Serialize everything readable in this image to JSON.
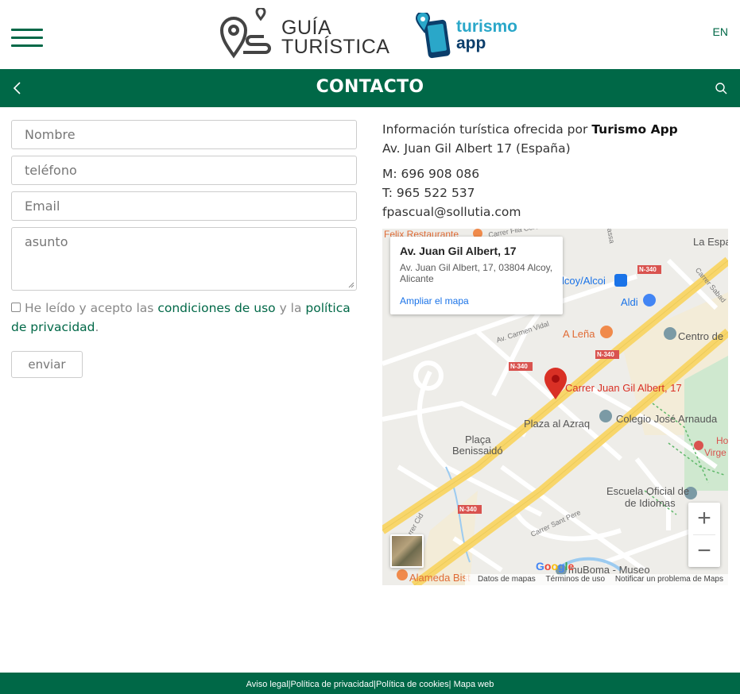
{
  "header": {
    "logo_guia_line1": "GUÍA",
    "logo_guia_line2": "TURÍSTICA",
    "logo_turismo_line1": "turismo",
    "logo_turismo_line2": "app",
    "lang": "EN"
  },
  "titlebar": {
    "title": "CONTACTO"
  },
  "form": {
    "name_placeholder": "Nombre",
    "phone_placeholder": "teléfono",
    "email_placeholder": "Email",
    "subject_placeholder": "asunto",
    "consent_prefix": "He leído y acepto las ",
    "terms_link": "condiciones de uso",
    "consent_middle": " y la ",
    "privacy_link": "política de privacidad",
    "consent_suffix": ".",
    "send_label": "enviar"
  },
  "info": {
    "intro": "Información turística ofrecida por ",
    "company": "Turismo App",
    "address": "Av. Juan Gil Albert 17 (España)",
    "mobile": "M: 696 908 086",
    "phone": "T: 965 522 537",
    "email": "fpascual@sollutia.com"
  },
  "map": {
    "popup_title": "Av. Juan Gil Albert, 17",
    "popup_address": "Av. Juan Gil Albert, 17, 03804 Alcoy, Alicante",
    "popup_link": "Ampliar el mapa",
    "marker_label": "Carrer Juan Gil Albert, 17",
    "place_labels": {
      "felix": "Felix Restaurante",
      "filacordo": "Carrer Filà Cordó",
      "laespa": "La Espa",
      "alcoy": "lcoy/Alcoi",
      "aldi": "Aldi",
      "carmen": "Av. Carmen Vidal",
      "alena": "A Leña",
      "centro": "Centro de",
      "plaza": "Plaza al Azraq",
      "colegio": "Colegio José Arnauda",
      "placa1": "Plaça",
      "placa2": "Benissaidó",
      "escuela1": "Escuela Oficial de",
      "escuela2": "de Idiomas",
      "santpere": "Carrer Sant Pere",
      "alameda": "Alameda Bist",
      "muboma": "muBoma - Museo",
      "virge": "Virge",
      "ho": "Ho",
      "cid": "Carrer Cid",
      "sabadell": "Carrer Sabad",
      "assa": "assa"
    },
    "road_badge": "N-340",
    "zoom_in": "+",
    "zoom_out": "−",
    "footer_data": "Datos de mapas",
    "footer_terms": "Términos de uso",
    "footer_report": "Notificar un problema de Maps",
    "google": "Google"
  },
  "footer": {
    "legal": "Aviso legal",
    "privacy": "Política de privacidad",
    "cookies": "Política de cookies",
    "sitemap": " Mapa web"
  },
  "colors": {
    "brand_green": "#006847",
    "link_blue": "#1a73e8",
    "marker_red": "#d93025",
    "road_yellow": "#f8d66b"
  },
  "icons": [
    "hamburger-icon",
    "map-pin-logo-icon",
    "phone-logo-icon",
    "chevron-left-icon",
    "search-icon",
    "map-marker-icon"
  ]
}
